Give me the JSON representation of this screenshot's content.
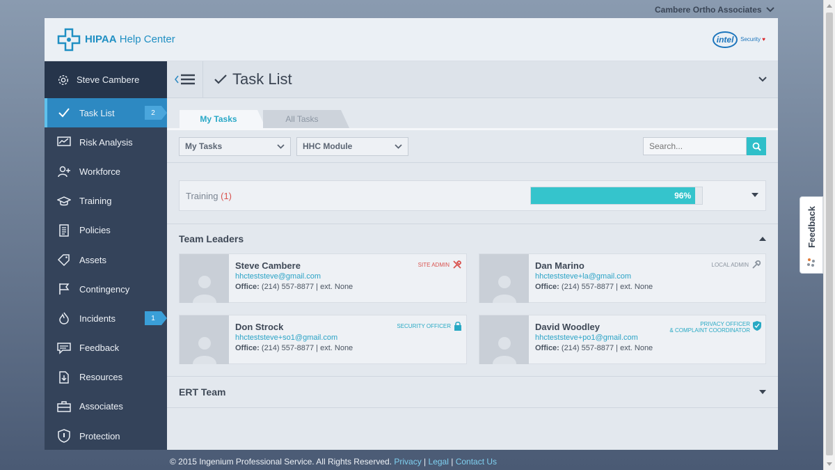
{
  "org": {
    "name": "Cambere Ortho Associates"
  },
  "app": {
    "title_bold": "HIPAA",
    "title_rest": " Help Center",
    "partner_logo": "intel",
    "partner_sub": "Security"
  },
  "sidebar": {
    "user": "Steve Cambere",
    "items": [
      {
        "label": "Task List",
        "icon": "check-icon",
        "badge": "2",
        "active": true
      },
      {
        "label": "Risk Analysis",
        "icon": "chart-icon"
      },
      {
        "label": "Workforce",
        "icon": "add-user-icon"
      },
      {
        "label": "Training",
        "icon": "graduation-cap-icon"
      },
      {
        "label": "Policies",
        "icon": "document-icon"
      },
      {
        "label": "Assets",
        "icon": "tag-icon"
      },
      {
        "label": "Contingency",
        "icon": "flag-icon"
      },
      {
        "label": "Incidents",
        "icon": "fire-icon",
        "badge": "1"
      },
      {
        "label": "Feedback",
        "icon": "comment-icon"
      },
      {
        "label": "Resources",
        "icon": "download-icon"
      },
      {
        "label": "Associates",
        "icon": "briefcase-icon"
      },
      {
        "label": "Protection",
        "icon": "shield-icon"
      }
    ]
  },
  "main": {
    "title": "Task List",
    "tabs": {
      "my": "My Tasks",
      "all": "All Tasks"
    },
    "filters": {
      "tasks": "My Tasks",
      "module": "HHC Module"
    },
    "search": {
      "placeholder": "Search..."
    },
    "training": {
      "label": "Training",
      "count": "(1)",
      "progress_text": "96%",
      "progress": 96
    },
    "team_leaders": {
      "title": "Team Leaders",
      "members": [
        {
          "name": "Steve Cambere",
          "email": "hhcteststeve@gmail.com",
          "office_label": "Office:",
          "office": " (214) 557-8877 | ext. None",
          "role": "SITE ADMIN"
        },
        {
          "name": "Dan Marino",
          "email": "hhcteststeve+la@gmail.com",
          "office_label": "Office:",
          "office": " (214) 557-8877 | ext. None",
          "role": "LOCAL ADMIN"
        },
        {
          "name": "Don Strock",
          "email": "hhcteststeve+so1@gmail.com",
          "office_label": "Office:",
          "office": " (214) 557-8877 | ext. None",
          "role": "SECURITY OFFICER"
        },
        {
          "name": "David Woodley",
          "email": "hhcteststeve+po1@gmail.com",
          "office_label": "Office:",
          "office": " (214) 557-8877 | ext. None",
          "role_line1": "PRIVACY OFFICER",
          "role_line2": "& COMPLAINT COORDINATOR"
        }
      ]
    },
    "ert_team": {
      "title": "ERT Team"
    }
  },
  "footer": {
    "copyright": "© 2015 Ingenium Professional Service. All Rights Reserved.",
    "privacy": "Privacy",
    "sep": "|",
    "legal": "Legal",
    "contact": "Contact Us"
  },
  "feedback_tab": {
    "label": "Feedback"
  },
  "colors": {
    "accent": "#2fbfc9",
    "sidebar": "#34435a",
    "active": "#2d89c2",
    "danger": "#d9534f"
  }
}
